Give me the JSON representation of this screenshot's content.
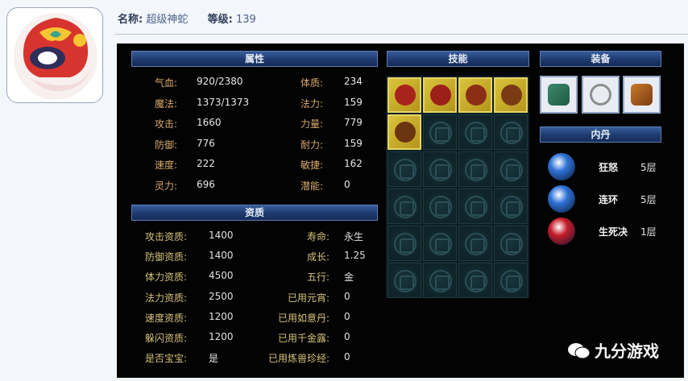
{
  "header": {
    "name_label": "名称:",
    "name_value": "超级神蛇",
    "level_label": "等级:",
    "level_value": "139"
  },
  "sections": {
    "attributes": "属性",
    "skills": "技能",
    "equipment": "装备",
    "neidan": "内丹",
    "aptitude": "资质"
  },
  "attributes": [
    {
      "label": "气血:",
      "value": "920/2380"
    },
    {
      "label": "魔法:",
      "value": "1373/1373"
    },
    {
      "label": "攻击:",
      "value": "1660"
    },
    {
      "label": "防御:",
      "value": "776"
    },
    {
      "label": "速度:",
      "value": "222"
    },
    {
      "label": "灵力:",
      "value": "696"
    }
  ],
  "attributes_right": [
    {
      "label": "体质:",
      "value": "234"
    },
    {
      "label": "法力:",
      "value": "159"
    },
    {
      "label": "力量:",
      "value": "779"
    },
    {
      "label": "耐力:",
      "value": "159"
    },
    {
      "label": "敏捷:",
      "value": "162"
    },
    {
      "label": "潜能:",
      "value": "0"
    }
  ],
  "aptitude": [
    {
      "label": "攻击资质:",
      "value": "1400"
    },
    {
      "label": "防御资质:",
      "value": "1400"
    },
    {
      "label": "体力资质:",
      "value": "4500"
    },
    {
      "label": "法力资质:",
      "value": "2500"
    },
    {
      "label": "速度资质:",
      "value": "1200"
    },
    {
      "label": "躲闪资质:",
      "value": "1200"
    },
    {
      "label": "是否宝宝:",
      "value": "是"
    }
  ],
  "aptitude_right": [
    {
      "label": "寿命:",
      "value": "永生"
    },
    {
      "label": "成长:",
      "value": "1.25"
    },
    {
      "label": "五行:",
      "value": "金"
    },
    {
      "label": "已用元宵:",
      "value": "0"
    },
    {
      "label": "已用如意丹:",
      "value": "0"
    },
    {
      "label": "已用千金露:",
      "value": "0"
    },
    {
      "label": "已用炼兽珍经:",
      "value": "0"
    }
  ],
  "skills": [
    "mask-icon",
    "eye-icon",
    "sword-icon",
    "figure-icon",
    "bow-icon"
  ],
  "equipment": [
    "armor-icon",
    "necklace-icon",
    "vest-icon"
  ],
  "neidan": [
    {
      "name": "狂怒",
      "level": "5层",
      "color": "#2f73d9"
    },
    {
      "name": "连环",
      "level": "5层",
      "color": "#2f73d9"
    },
    {
      "name": "生死决",
      "level": "1层",
      "color": "#c81d2a"
    }
  ],
  "watermark": "九分游戏"
}
